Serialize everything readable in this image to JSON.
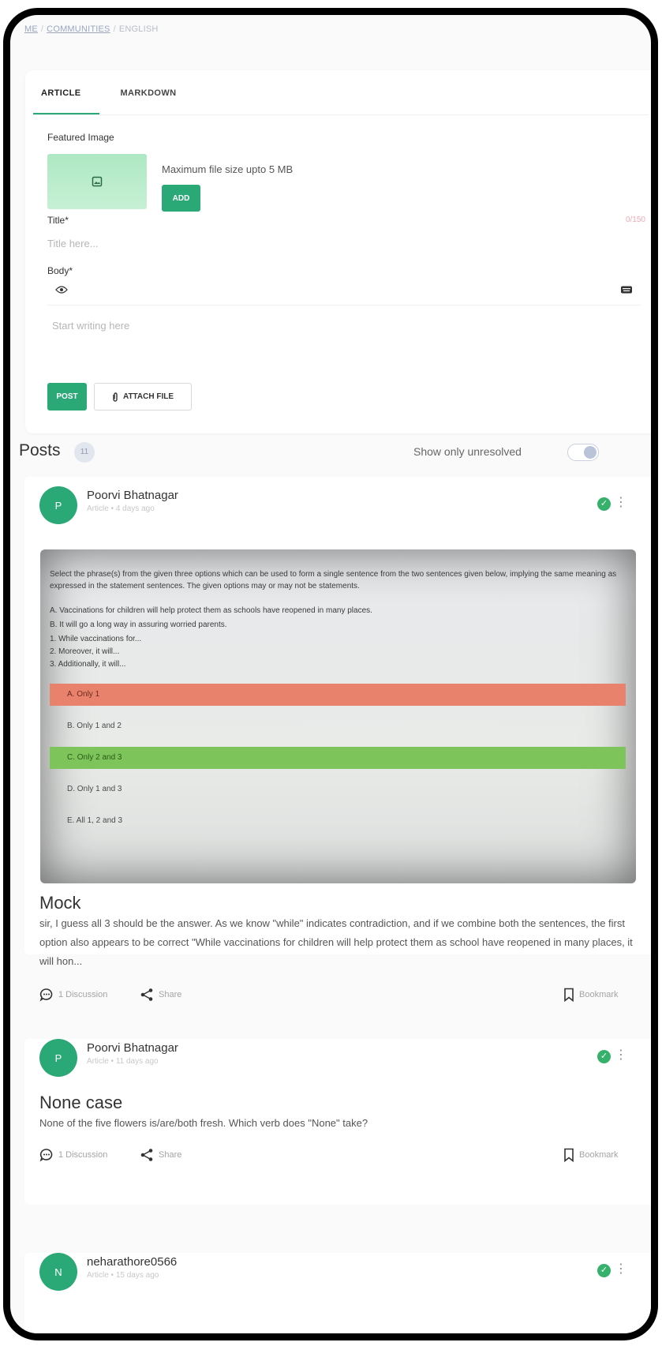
{
  "breadcrumb": {
    "home": "ME",
    "communities": "COMMUNITIES",
    "current": "ENGLISH"
  },
  "editor": {
    "tabs": [
      {
        "label": "ARTICLE"
      },
      {
        "label": "MARKDOWN"
      }
    ],
    "featured_image_label": "Featured Image",
    "image_icon": "image-icon",
    "max_size_text": "Maximum file size upto 5 MB",
    "add_label": "ADD",
    "title_label": "Title*",
    "title_hint": "0/150",
    "title_placeholder": "Title here...",
    "body_label": "Body*",
    "body_placeholder": "Start writing here",
    "post_label": "POST",
    "attach_label": "ATTACH FILE"
  },
  "posts": {
    "title": "Posts",
    "count": "11",
    "unresolved_label": "Show only unresolved",
    "unresolved_on": false,
    "items": [
      {
        "avatar_letter": "P",
        "author": "Poorvi Bhatnagar",
        "meta": "Article • 4 days ago",
        "has_image": true,
        "title": "Mock",
        "body": "sir, I guess all 3 should be the answer. As we know \"while\" indicates contradiction, and if we combine both the sentences, the first option also appears to be correct \"While vaccinations for children will help protect them as school have reopened in many places, it will hon...",
        "discussion": "1 Discussion",
        "share": "Share",
        "bookmark": "Bookmark"
      },
      {
        "avatar_letter": "P",
        "author": "Poorvi Bhatnagar",
        "meta": "Article • 11 days ago",
        "has_image": false,
        "title": "None case",
        "body": "None of the five flowers is/are/both fresh. Which verb does \"None\" take?",
        "discussion": "1 Discussion",
        "share": "Share",
        "bookmark": "Bookmark"
      },
      {
        "avatar_letter": "N",
        "author": "neharathore0566",
        "meta": "Article • 15 days ago"
      }
    ]
  },
  "question_image": {
    "question": "Select the phrase(s) from the given three options which can be used to form a single sentence from the two sentences given below, implying the same meaning as expressed in the statement sentences. The given options may or may not be statements.",
    "line_a": "A. Vaccinations for children will help protect them as schools have reopened in many places.",
    "line_b": "B. It will go a long way in assuring worried parents.",
    "opt1": "1. While vaccinations for...",
    "opt2": "2. Moreover, it will...",
    "opt3": "3. Additionally, it will...",
    "answers": [
      {
        "label": "A. Only 1",
        "state": "wrong"
      },
      {
        "label": "B. Only 1 and 2",
        "state": "none"
      },
      {
        "label": "C. Only 2 and 3",
        "state": "correct"
      },
      {
        "label": "D. Only 1 and 3",
        "state": "none"
      },
      {
        "label": "E. All 1, 2 and 3",
        "state": "none"
      }
    ]
  },
  "colors": {
    "accent": "#2aa876",
    "check": "#35b16b",
    "wrong": "#e9826c",
    "correct": "#7dc45a"
  }
}
